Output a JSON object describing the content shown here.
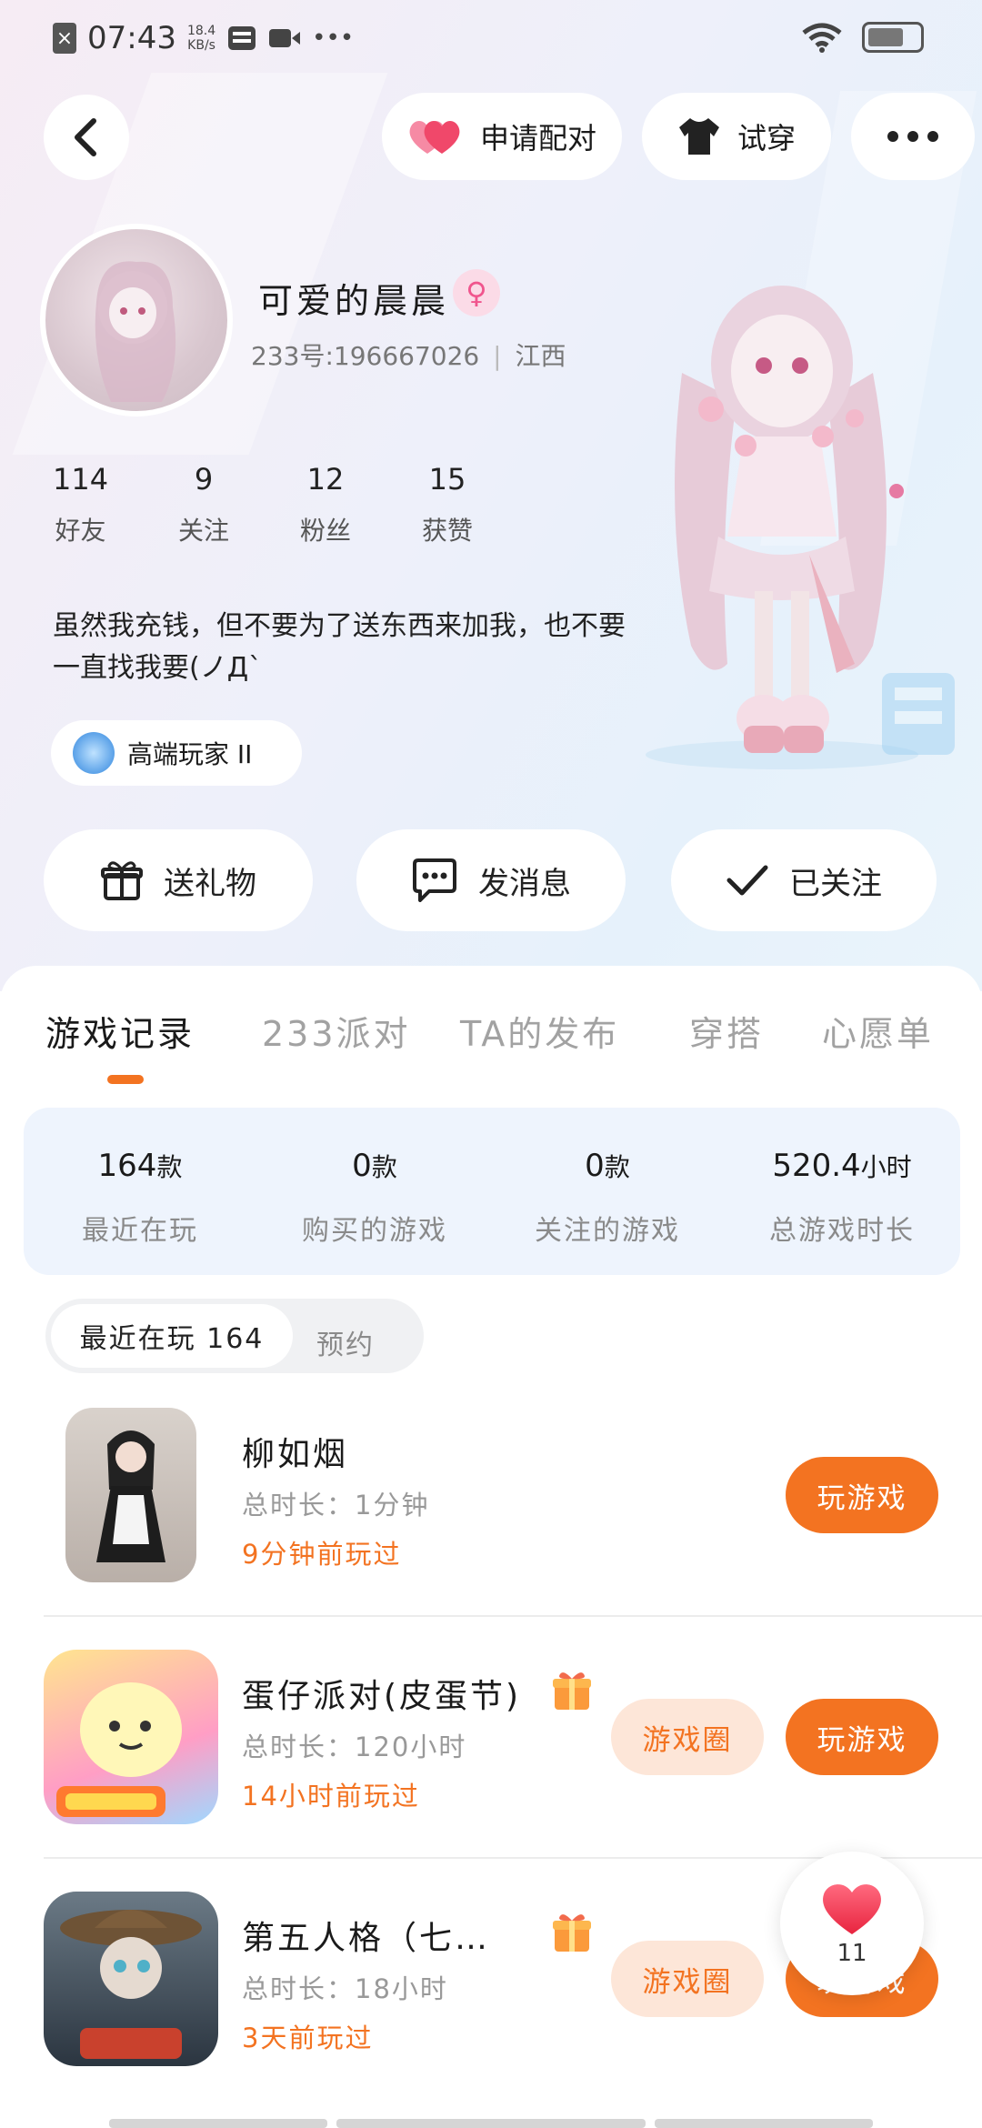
{
  "status_bar": {
    "time": "07:43",
    "speed_value": "18.4",
    "speed_unit": "KB/s",
    "dots": "•••",
    "icons": [
      "close-notification-icon",
      "sim-icon",
      "video-icon",
      "wifi-icon",
      "battery-icon"
    ]
  },
  "header": {
    "back_icon": "chevron-left-icon",
    "match_label": "申请配对",
    "tryon_label": "试穿",
    "more_icon": "more-dots-icon"
  },
  "profile": {
    "name": "可爱的晨晨",
    "gender_symbol": "♀",
    "uid_line": "233号:196667026",
    "location": "江西",
    "stats": [
      {
        "value": "114",
        "label": "好友"
      },
      {
        "value": "9",
        "label": "关注"
      },
      {
        "value": "12",
        "label": "粉丝"
      },
      {
        "value": "15",
        "label": "获赞"
      }
    ],
    "bio": "虽然我充钱，但不要为了送东西来加我，也不要一直找我要(ノД`",
    "badge_label": "高端玩家 II"
  },
  "actions": {
    "gift": "送礼物",
    "message": "发消息",
    "followed": "已关注"
  },
  "tabs": [
    "游戏记录",
    "233派对",
    "TA的发布",
    "穿搭",
    "心愿单"
  ],
  "summary": [
    {
      "value": "164",
      "unit": "款",
      "label": "最近在玩"
    },
    {
      "value": "0",
      "unit": "款",
      "label": "购买的游戏"
    },
    {
      "value": "0",
      "unit": "款",
      "label": "关注的游戏"
    },
    {
      "value": "520.4",
      "unit": "小时",
      "label": "总游戏时长"
    }
  ],
  "segment": {
    "active": "最近在玩 164",
    "inactive": "预约"
  },
  "games": [
    {
      "title": "柳如烟",
      "duration": "总时长：1分钟",
      "last_played": "9分钟前玩过",
      "play_label": "玩游戏"
    },
    {
      "title": "蛋仔派对(皮蛋节)",
      "duration": "总时长：120小时",
      "last_played": "14小时前玩过",
      "circle_label": "游戏圈",
      "play_label": "玩游戏"
    },
    {
      "title": "第五人格（七…",
      "duration": "总时长：18小时",
      "last_played": "3天前玩过",
      "circle_label": "游戏圈",
      "play_label": "玩游戏"
    }
  ],
  "float_like": {
    "count": "11"
  },
  "colors": {
    "accent": "#f37321",
    "accent_light": "#fde6d8",
    "heart": "#f0486a",
    "summary_bg": "#eef4fd"
  }
}
